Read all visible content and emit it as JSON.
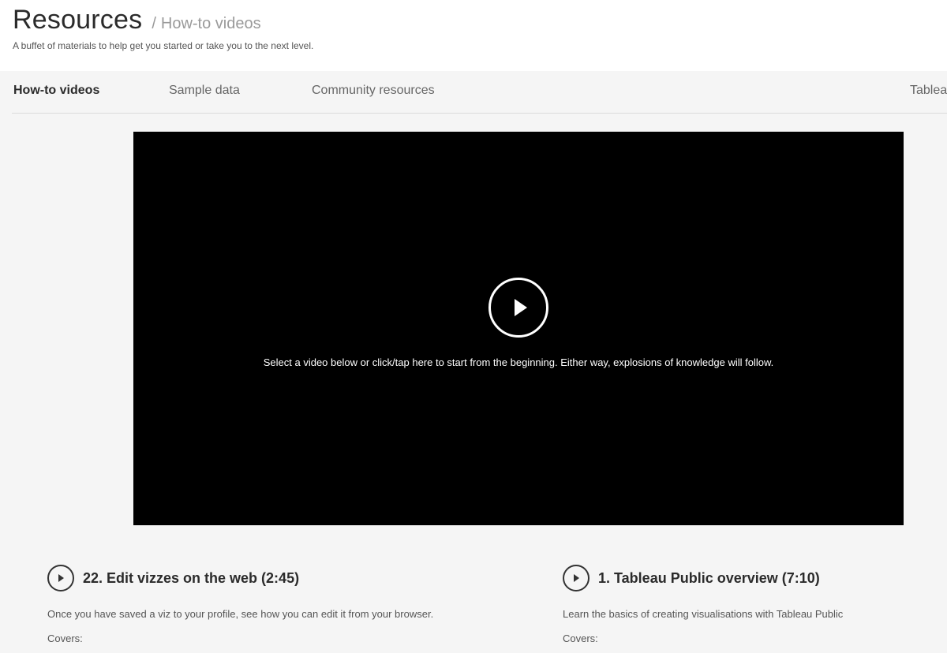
{
  "header": {
    "title": "Resources",
    "breadcrumb_separator": "/",
    "breadcrumb_current": "How-to videos",
    "subtitle": "A buffet of materials to help get you started or take you to the next level."
  },
  "tabs": [
    {
      "label": "How-to videos",
      "active": true
    },
    {
      "label": "Sample data",
      "active": false
    },
    {
      "label": "Community resources",
      "active": false
    },
    {
      "label": "Tableau",
      "active": false
    }
  ],
  "player": {
    "play_icon": "play-circle-icon",
    "caption": "Select a video below or click/tap here to start from the beginning. Either way, explosions of knowledge will follow."
  },
  "videos": [
    {
      "title": "22. Edit vizzes on the web (2:45)",
      "description": "Once you have saved a viz to your profile, see how you can edit it from your browser.",
      "covers_label": "Covers:"
    },
    {
      "title": "1. Tableau Public overview (7:10)",
      "description": "Learn the basics of creating visualisations with Tableau Public",
      "covers_label": "Covers:"
    }
  ],
  "colors": {
    "background": "#f5f5f5",
    "header_background": "#ffffff",
    "player_background": "#000000",
    "text_dark": "#2b2b2b",
    "text_muted": "#9a9a9a"
  }
}
